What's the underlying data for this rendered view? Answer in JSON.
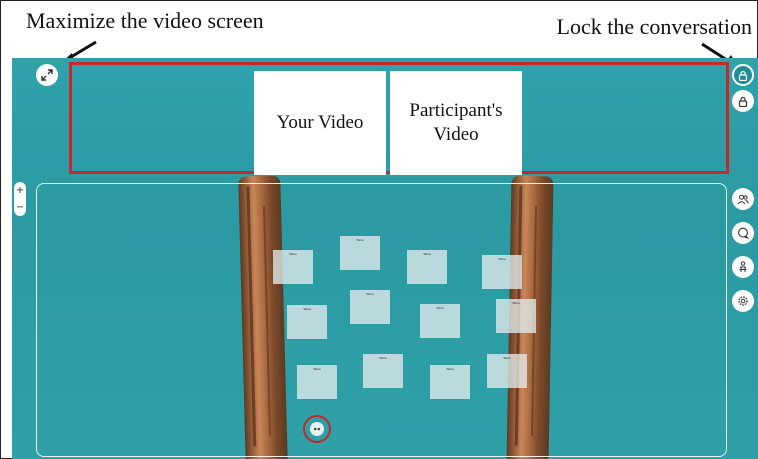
{
  "annotations": {
    "maximize_caption": "Maximize the video screen",
    "lock_caption": "Lock the conversation"
  },
  "video_bar": {
    "your_video": "Your Video",
    "participant_video": "Participant's Video"
  },
  "zoom": {
    "plus": "+",
    "minus": "−"
  },
  "tables": [
    "Table",
    "Table",
    "Table",
    "Table",
    "Table",
    "Table",
    "Table",
    "Table",
    "Table",
    "Table",
    "Table",
    "Table"
  ],
  "icons": {
    "maximize": "expand-icon",
    "lock_active": "lock-icon",
    "lock": "lock-icon",
    "people": "people-icon",
    "chat": "chat-icon",
    "podium": "presenter-icon",
    "settings": "gear-icon",
    "avatar": "avatar-icon"
  },
  "colors": {
    "background": "#2fa2ab",
    "highlight": "#c62828",
    "tile": "#ffffff"
  }
}
